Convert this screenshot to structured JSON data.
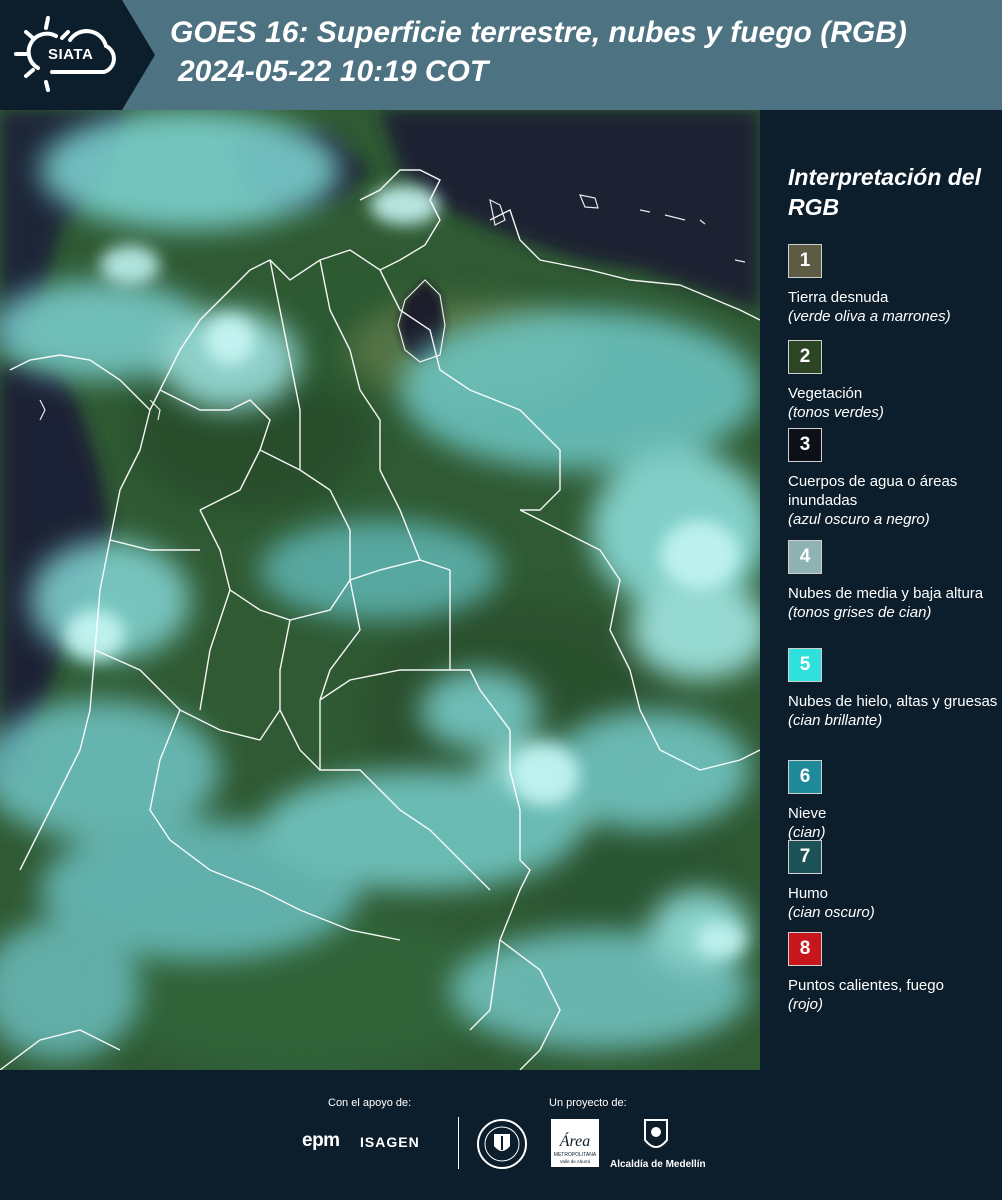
{
  "header": {
    "logo_text": "SIATA",
    "title": "GOES 16: Superficie terrestre, nubes y fuego (RGB)",
    "subtitle": "2024-05-22 10:19 COT",
    "logo_icon": "sun-cloud-icon"
  },
  "colors": {
    "header_band": "#4d7282",
    "background": "#0c1e2b",
    "vegetation": "#2f5a33",
    "cloud_cyan": "#7fe3e0",
    "ocean_dark": "#1a2030",
    "border_white": "#ffffff"
  },
  "legend": {
    "title": "Interpretación del RGB",
    "items": [
      {
        "num": "1",
        "label": "Tierra desnuda",
        "hint": "(verde oliva a marrones)",
        "color": "#5e5b44"
      },
      {
        "num": "2",
        "label": "Vegetación",
        "hint": "(tonos verdes)",
        "color": "#2c4524"
      },
      {
        "num": "3",
        "label": "Cuerpos de agua o áreas inundadas",
        "hint": "(azul oscuro a negro)",
        "color": "#0d1117"
      },
      {
        "num": "4",
        "label": "Nubes de media y baja altura",
        "hint": "(tonos grises de cian)",
        "color": "#8fb3b3"
      },
      {
        "num": "5",
        "label": "Nubes de hielo, altas y gruesas",
        "hint": "(cian brillante)",
        "color": "#2fe0dd"
      },
      {
        "num": "6",
        "label": "Nieve",
        "hint": "(cian)",
        "color": "#1f8a9a"
      },
      {
        "num": "7",
        "label": "Humo",
        "hint": "(cian oscuro)",
        "color": "#1d5358"
      },
      {
        "num": "8",
        "label": "Puntos calientes, fuego",
        "hint": "(rojo)",
        "color": "#c8161d"
      }
    ]
  },
  "footer": {
    "support_label": "Con el apoyo de:",
    "project_label": "Un proyecto de:",
    "epm": "epm",
    "isagen": "ISAGEN",
    "area_metropolitana": "Área",
    "area_metropolitana_sub": "METROPOLITANA",
    "area_metropolitana_sub2": "Valle de Aburrá",
    "alcaldia": "Alcaldía de Medellín"
  }
}
